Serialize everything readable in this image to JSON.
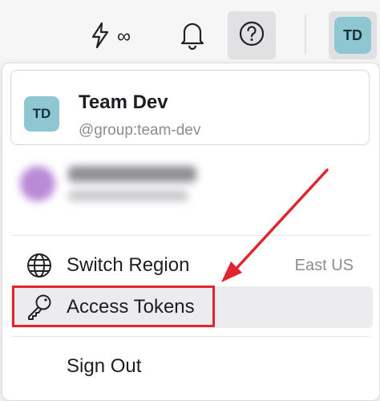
{
  "topbar": {
    "credits_symbol": "∞",
    "icons": [
      "bolt-icon",
      "bell-icon",
      "help-icon"
    ],
    "avatar_initials": "TD"
  },
  "account": {
    "initials": "TD",
    "name": "Team Dev",
    "handle": "@group:team-dev"
  },
  "menu": {
    "items": [
      {
        "label": "Switch Region",
        "value": "East US",
        "icon": "globe-icon"
      },
      {
        "label": "Access Tokens",
        "icon": "key-icon"
      },
      {
        "label": "Sign Out"
      }
    ]
  },
  "colors": {
    "avatar_bg": "#8ec6d2",
    "highlight": "#e0252f",
    "annotation_arrow": "#e0252f"
  }
}
